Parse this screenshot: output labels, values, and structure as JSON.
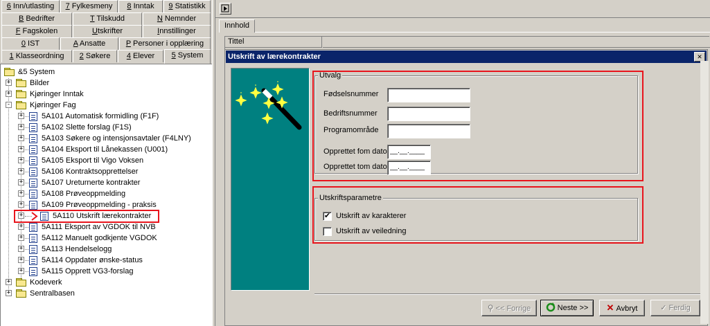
{
  "tabs": {
    "row1": [
      {
        "key": "6",
        "rest": " Inn/utlasting"
      },
      {
        "key": "7",
        "rest": " Fylkesmeny"
      },
      {
        "key": "8",
        "rest": " Inntak"
      },
      {
        "key": "9",
        "rest": " Statistikk"
      }
    ],
    "row2": [
      {
        "key": "B",
        "rest": " Bedrifter"
      },
      {
        "key": "T",
        "rest": " Tilskudd"
      },
      {
        "key": "N",
        "rest": " Nemnder"
      }
    ],
    "row3": [
      {
        "key": "F",
        "rest": " Fagskolen"
      },
      {
        "key": "U",
        "rest": "tskrifter"
      },
      {
        "key": "I",
        "rest": "nnstillinger"
      }
    ],
    "row4": [
      {
        "key": "0",
        "rest": " IST"
      },
      {
        "key": "A",
        "rest": " Ansatte"
      },
      {
        "key": "P",
        "rest": " Personer i opplæring"
      }
    ],
    "row5": [
      {
        "key": "1",
        "rest": " Klasseordning"
      },
      {
        "key": "2",
        "rest": " Søkere"
      },
      {
        "key": "4",
        "rest": " Elever"
      },
      {
        "key": "5",
        "rest": " System"
      }
    ]
  },
  "tree": {
    "root": "&5 System",
    "folders": [
      "Bilder",
      "Kjøringer Inntak",
      "Kjøringer Fag",
      "Kodeverk",
      "Sentralbasen"
    ],
    "items": [
      "5A101 Automatisk formidling (F1F)",
      "5A102 Slette forslag (F1S)",
      "5A103 Søkere og intensjonsavtaler (F4LNY)",
      "5A104 Eksport til Lånekassen (U001)",
      "5A105 Eksport til Vigo Voksen",
      "5A106 Kontraktsopprettelser",
      "5A107 Ureturnerte kontrakter",
      "5A108 Prøveoppmelding",
      "5A109 Prøveoppmelding - praksis",
      "5A110 Utskrift lærekontrakter",
      "5A111 Eksport av VGDOK til NVB",
      "5A112 Manuelt godkjente VGDOK",
      "5A113 Hendelselogg",
      "5A114 Oppdater ønske-status",
      "5A115 Opprett VG3-forslag"
    ],
    "selected_index": 9
  },
  "right": {
    "tab_label": "Innhold",
    "column_header": "Tittel",
    "dialog_title": "Utskrift av lærekontrakter",
    "close_glyph": "✕",
    "group_utvalg": "Utvalg",
    "fields": [
      {
        "label": "Fødselsnummer",
        "value": ""
      },
      {
        "label": "Bedriftsnummer",
        "value": ""
      },
      {
        "label": "Programområde",
        "value": ""
      }
    ],
    "date_fields": [
      {
        "label": "Opprettet fom dato",
        "value": "__.__.____"
      },
      {
        "label": "Opprettet tom dato",
        "value": "__.__.____"
      }
    ],
    "group_params": "Utskriftsparametre",
    "checkboxes": [
      {
        "label": "Utskrift av karakterer",
        "checked": true,
        "mark": "✔"
      },
      {
        "label": "Utskrift av veiledning",
        "checked": false,
        "mark": ""
      }
    ],
    "buttons": {
      "back": "<< Forrige",
      "next": "Neste >>",
      "cancel": "Avbryt",
      "finish": "Ferdig"
    }
  },
  "colors": {
    "window_bg": "#d4d0c8",
    "title_bar": "#0a246a",
    "wizard_panel": "#008080",
    "highlight": "#e8141c"
  }
}
